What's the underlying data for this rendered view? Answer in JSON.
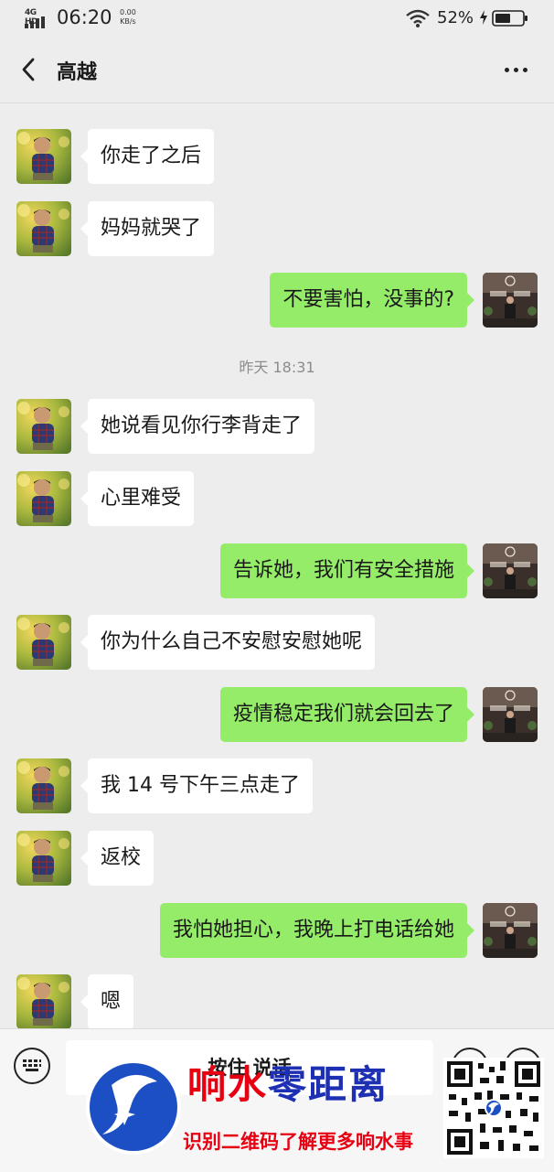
{
  "status_bar": {
    "network": "4G HD",
    "time": "06:20",
    "speed_value": "0.00",
    "speed_unit": "KB/s",
    "battery": "52%"
  },
  "header": {
    "title": "高越",
    "back_icon": "chevron-left-icon",
    "more_icon": "more-dots-icon"
  },
  "messages": [
    {
      "side": "in",
      "text": "你走了之后"
    },
    {
      "side": "in",
      "text": "妈妈就哭了"
    },
    {
      "side": "out",
      "text": "不要害怕，没事的?"
    },
    {
      "side": "in",
      "text": "她说看见你行李背走了"
    },
    {
      "side": "in",
      "text": "心里难受"
    },
    {
      "side": "out",
      "text": "告诉她，我们有安全措施"
    },
    {
      "side": "in",
      "text": "你为什么自己不安慰安慰她呢"
    },
    {
      "side": "out",
      "text": "疫情稳定我们就会回去了"
    },
    {
      "side": "in",
      "text": "我 14 号下午三点走了"
    },
    {
      "side": "in",
      "text": "返校"
    },
    {
      "side": "out",
      "text": "我怕她担心，我晚上打电话给她"
    },
    {
      "side": "in",
      "text": "嗯"
    }
  ],
  "time_separator": "昨天 18:31",
  "input_bar": {
    "voice_label": "按住 说话",
    "left_icon": "keyboard-icon",
    "right_icons": [
      "emoji-icon",
      "plus-icon"
    ]
  },
  "watermark": {
    "title_red": "响水",
    "title_blue": "零距离",
    "subtitle": "识别二维码了解更多响水事"
  },
  "colors": {
    "background": "#ededed",
    "incoming_bubble": "#ffffff",
    "outgoing_bubble": "#95ec69",
    "watermark_red": "#e60012",
    "watermark_blue": "#1d2fb3"
  }
}
